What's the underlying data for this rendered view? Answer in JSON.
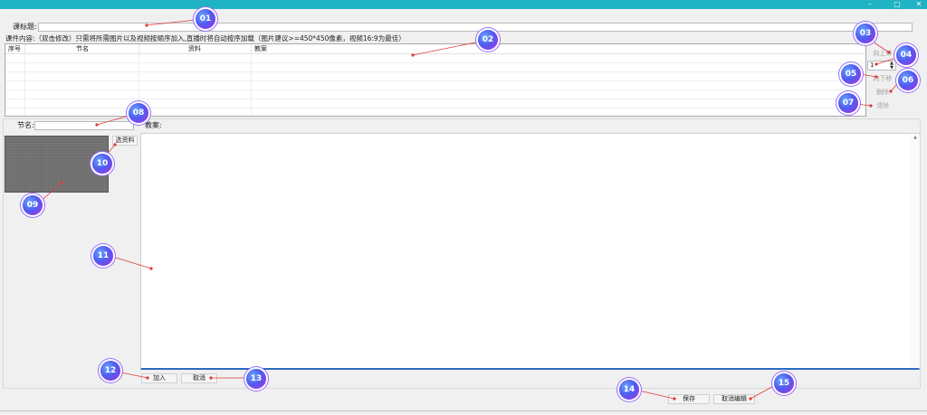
{
  "window": {
    "controls": [
      "–",
      "▢",
      "✕"
    ]
  },
  "form": {
    "course_title_label": "课标题:",
    "course_title_value": "",
    "content_label": "课件内容:（双击修改）只需将所需图片以及视频按顺序加入,直播时将自动按序加载（图片建议>=450*450像素，视频16:9为最佳）",
    "table": {
      "columns": [
        "序号",
        "节名",
        "资料",
        "教案"
      ],
      "rows": []
    },
    "side_buttons": {
      "move_up": "向上移",
      "index_value": "1",
      "move_down": "向下移",
      "delete": "删除",
      "clear": "清除"
    },
    "section_name_label": "节名:",
    "section_name_value": "",
    "lesson_plan_label": "教案:",
    "select_material_button": "选资料",
    "add_button": "加入",
    "cancel_button": "取消",
    "save_button": "保存",
    "cancel_edit_button": "取消编辑"
  },
  "annotations": [
    "01",
    "02",
    "03",
    "04",
    "05",
    "06",
    "07",
    "08",
    "09",
    "10",
    "11",
    "12",
    "13",
    "14",
    "15"
  ],
  "colors": {
    "title_bar": "#1fb3c3",
    "editor_underline": "#2a6ac2",
    "badge_start": "#4f5cf0",
    "badge_end": "#b42be0",
    "leader_line": "#e03a3a"
  }
}
